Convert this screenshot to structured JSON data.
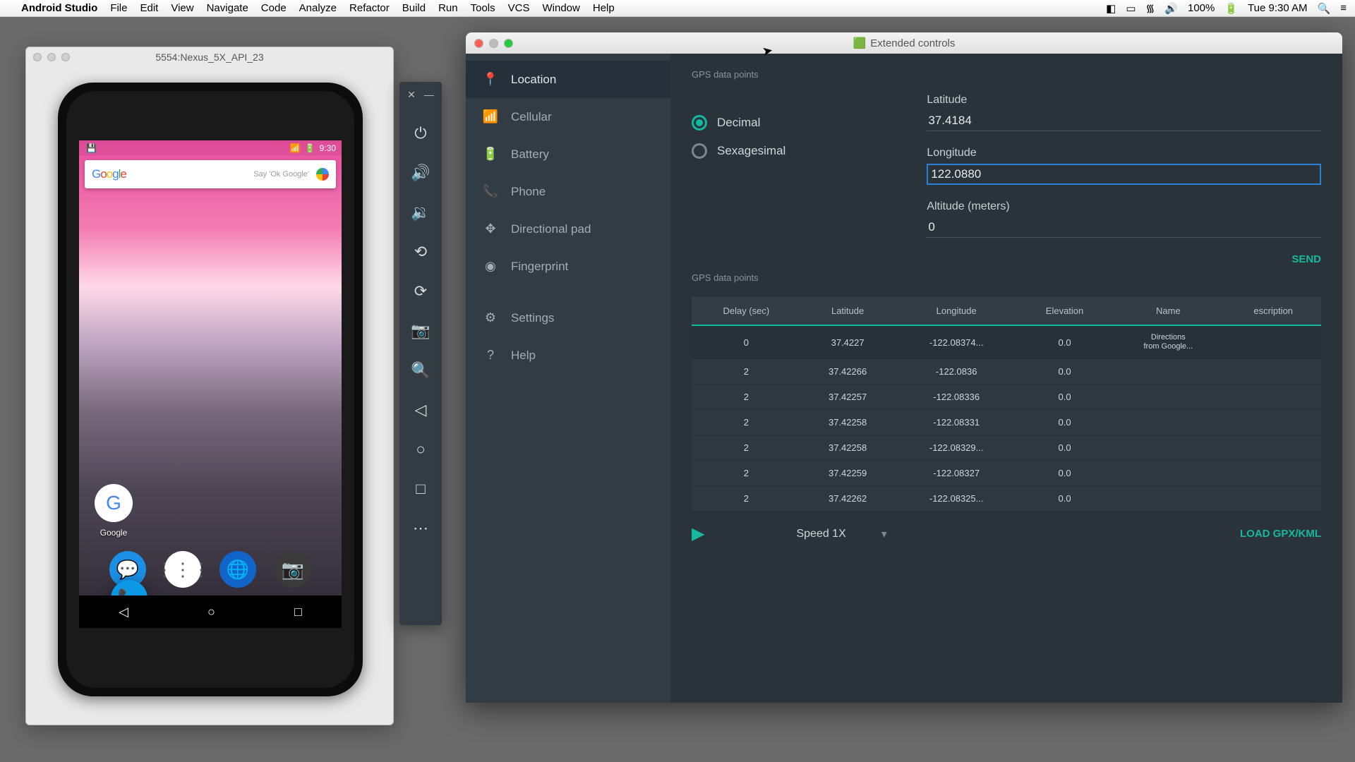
{
  "menubar": {
    "app": "Android Studio",
    "items": [
      "File",
      "Edit",
      "View",
      "Navigate",
      "Code",
      "Analyze",
      "Refactor",
      "Build",
      "Run",
      "Tools",
      "VCS",
      "Window",
      "Help"
    ],
    "battery": "100%",
    "clock": "Tue 9:30 AM"
  },
  "emulator_window": {
    "title": "5554:Nexus_5X_API_23",
    "status_time": "9:30",
    "search_placeholder": "Say 'Ok Google'",
    "google_label": "Google"
  },
  "extended": {
    "title": "Extended controls",
    "nav": [
      "Location",
      "Cellular",
      "Battery",
      "Phone",
      "Directional pad",
      "Fingerprint",
      "Settings",
      "Help"
    ],
    "nav_active_index": 0,
    "section1": "GPS data points",
    "radio": {
      "decimal": "Decimal",
      "sexagesimal": "Sexagesimal",
      "selected": "decimal"
    },
    "fields": {
      "lat_label": "Latitude",
      "lat_value": "37.4184",
      "lon_label": "Longitude",
      "lon_value": "122.0880",
      "alt_label": "Altitude (meters)",
      "alt_value": "0"
    },
    "send": "SEND",
    "section2": "GPS data points",
    "columns": [
      "Delay (sec)",
      "Latitude",
      "Longitude",
      "Elevation",
      "Name",
      "escription"
    ],
    "rows": [
      {
        "delay": "0",
        "lat": "37.4227",
        "lon": "-122.08374...",
        "elev": "0.0",
        "name": "Directions\nfrom Google...",
        "desc": ""
      },
      {
        "delay": "2",
        "lat": "37.42266",
        "lon": "-122.0836",
        "elev": "0.0",
        "name": "",
        "desc": ""
      },
      {
        "delay": "2",
        "lat": "37.42257",
        "lon": "-122.08336",
        "elev": "0.0",
        "name": "",
        "desc": ""
      },
      {
        "delay": "2",
        "lat": "37.42258",
        "lon": "-122.08331",
        "elev": "0.0",
        "name": "",
        "desc": ""
      },
      {
        "delay": "2",
        "lat": "37.42258",
        "lon": "-122.08329...",
        "elev": "0.0",
        "name": "",
        "desc": ""
      },
      {
        "delay": "2",
        "lat": "37.42259",
        "lon": "-122.08327",
        "elev": "0.0",
        "name": "",
        "desc": ""
      },
      {
        "delay": "2",
        "lat": "37.42262",
        "lon": "-122.08325...",
        "elev": "0.0",
        "name": "",
        "desc": ""
      }
    ],
    "speed": "Speed 1X",
    "load": "LOAD GPX/KML"
  }
}
